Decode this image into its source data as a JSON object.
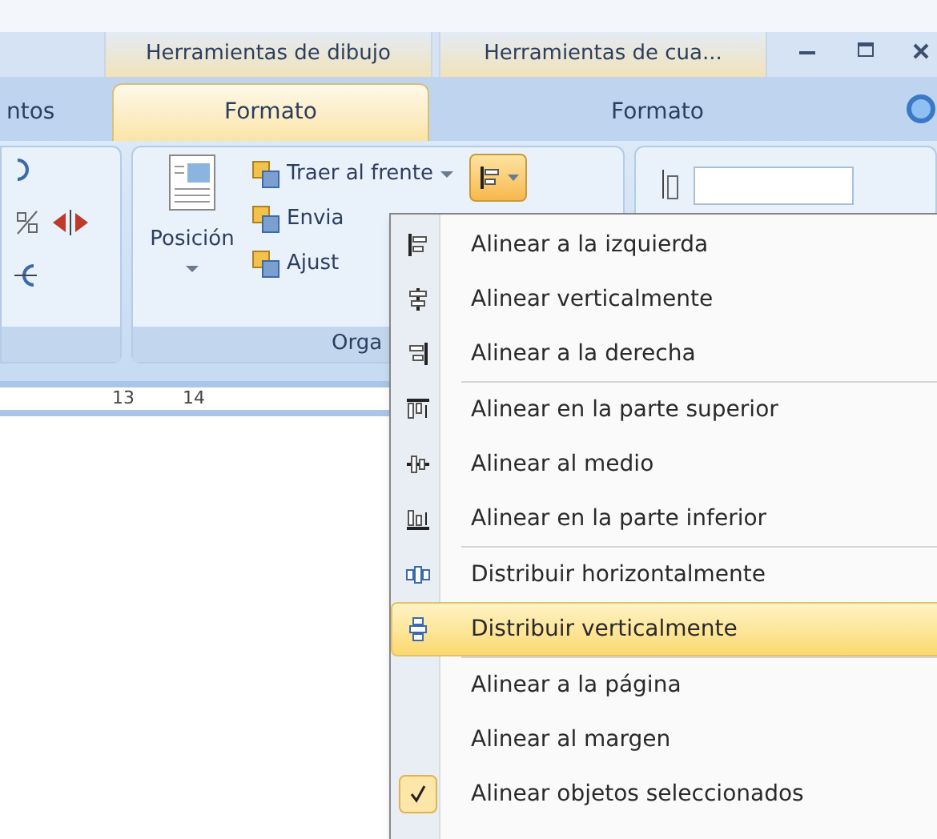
{
  "contextual_tabs": [
    {
      "label": "Herramientas de dibujo"
    },
    {
      "label": "Herramientas de cua..."
    }
  ],
  "tabs": [
    {
      "label": "ntos",
      "selected": false
    },
    {
      "label": "Formato",
      "selected": true
    },
    {
      "label": "Formato",
      "selected": false
    }
  ],
  "ribbon": {
    "posicion": {
      "label": "Posición"
    },
    "commands": [
      {
        "label": "Traer al frente",
        "dropdown": true
      },
      {
        "label": "Envia",
        "dropdown": false
      },
      {
        "label": "Ajust",
        "dropdown": false
      }
    ],
    "group_label": "Orga",
    "align_button": {
      "pressed": true
    }
  },
  "ruler": {
    "labels": [
      "13",
      "14"
    ]
  },
  "menu": {
    "groups": [
      [
        {
          "label": "Alinear a la izquierda",
          "checked": false,
          "highlighted": false
        },
        {
          "label": "Alinear verticalmente",
          "checked": false,
          "highlighted": false
        },
        {
          "label": "Alinear a la derecha",
          "checked": false,
          "highlighted": false
        }
      ],
      [
        {
          "label": "Alinear en la parte superior",
          "checked": false,
          "highlighted": false
        },
        {
          "label": "Alinear al medio",
          "checked": false,
          "highlighted": false
        },
        {
          "label": "Alinear en la parte inferior",
          "checked": false,
          "highlighted": false
        }
      ],
      [
        {
          "label": "Distribuir horizontalmente",
          "checked": false,
          "highlighted": false
        },
        {
          "label": "Distribuir verticalmente",
          "checked": false,
          "highlighted": true
        }
      ],
      [
        {
          "label": "Alinear a la página",
          "checked": false,
          "highlighted": false
        },
        {
          "label": "Alinear al margen",
          "checked": false,
          "highlighted": false
        },
        {
          "label": "Alinear objetos seleccionados",
          "checked": true,
          "highlighted": false
        }
      ]
    ]
  }
}
